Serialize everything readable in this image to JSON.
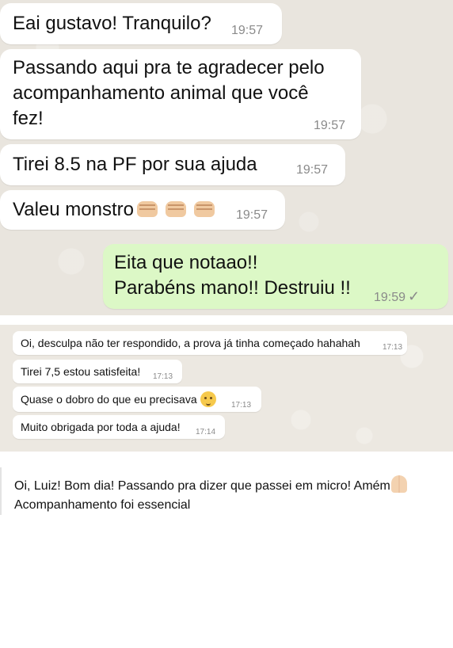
{
  "chat_one": {
    "messages": [
      {
        "text": "Eai gustavo! Tranquilo?",
        "time": "19:57",
        "direction": "in"
      },
      {
        "lines": [
          "Passando aqui pra te agradecer pelo",
          "acompanhamento animal que você",
          "fez!"
        ],
        "time": "19:57",
        "direction": "in"
      },
      {
        "text": "Tirei 8.5 na PF por sua ajuda",
        "time": "19:57",
        "direction": "in"
      },
      {
        "text": "Valeu monstro",
        "time": "19:57",
        "direction": "in",
        "emoji": "fist-bump x3"
      },
      {
        "lines": [
          "Eita que notaao!!",
          "Parabéns mano!! Destruiu !!"
        ],
        "time": "19:59",
        "direction": "out",
        "status_icon": "check-icon"
      }
    ],
    "colors": {
      "background": "#e9e5de",
      "incoming": "#ffffff",
      "outgoing": "#dcf8c6"
    }
  },
  "chat_two": {
    "messages": [
      {
        "text": "Oi, desculpa não ter respondido, a prova já tinha começado hahahah",
        "time": "17:13"
      },
      {
        "text": "Tirei 7,5 estou satisfeita!",
        "time": "17:13"
      },
      {
        "text": "Quase o dobro do que eu precisava",
        "time": "17:13",
        "emoji": "partying-face"
      },
      {
        "text": "Muito obrigada por toda a ajuda!",
        "time": "17:14"
      }
    ]
  },
  "message_three": {
    "line1": "Oi, Luiz! Bom dia! Passando pra dizer que passei em micro! Amém",
    "line2": "Acompanhamento foi essencial",
    "emoji": "folded-hands"
  }
}
